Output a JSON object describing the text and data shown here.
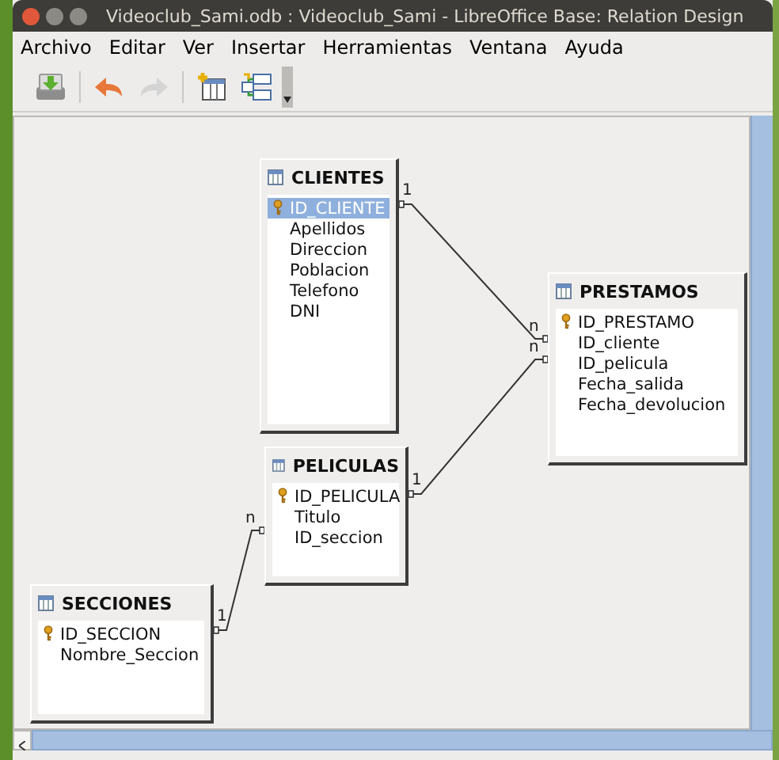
{
  "window": {
    "title": "Videoclub_Sami.odb : Videoclub_Sami - LibreOffice Base: Relation Design"
  },
  "menu": [
    "Archivo",
    "Editar",
    "Ver",
    "Insertar",
    "Herramientas",
    "Ventana",
    "Ayuda"
  ],
  "toolbar": [
    {
      "kind": "save",
      "disabled": false
    },
    {
      "kind": "undo",
      "disabled": false
    },
    {
      "kind": "redo",
      "disabled": true
    },
    {
      "kind": "add-table",
      "disabled": false
    },
    {
      "kind": "new-relation",
      "disabled": false
    }
  ],
  "tables": [
    {
      "name": "CLIENTES",
      "fields": [
        {
          "name": "ID_CLIENTE",
          "primary_key": true,
          "selected": true
        },
        {
          "name": "Apellidos",
          "primary_key": false,
          "selected": false
        },
        {
          "name": "Direccion",
          "primary_key": false,
          "selected": false
        },
        {
          "name": "Poblacion",
          "primary_key": false,
          "selected": false
        },
        {
          "name": "Telefono",
          "primary_key": false,
          "selected": false
        },
        {
          "name": "DNI",
          "primary_key": false,
          "selected": false
        }
      ]
    },
    {
      "name": "PRESTAMOS",
      "fields": [
        {
          "name": "ID_PRESTAMO",
          "primary_key": true,
          "selected": false
        },
        {
          "name": "ID_cliente",
          "primary_key": false,
          "selected": false
        },
        {
          "name": "ID_pelicula",
          "primary_key": false,
          "selected": false
        },
        {
          "name": "Fecha_salida",
          "primary_key": false,
          "selected": false
        },
        {
          "name": "Fecha_devolucion",
          "primary_key": false,
          "selected": false
        }
      ]
    },
    {
      "name": "PELICULAS",
      "fields": [
        {
          "name": "ID_PELICULA",
          "primary_key": true,
          "selected": false
        },
        {
          "name": "Titulo",
          "primary_key": false,
          "selected": false
        },
        {
          "name": "ID_seccion",
          "primary_key": false,
          "selected": false
        }
      ]
    },
    {
      "name": "SECCIONES",
      "fields": [
        {
          "name": "ID_SECCION",
          "primary_key": true,
          "selected": false
        },
        {
          "name": "Nombre_Seccion",
          "primary_key": false,
          "selected": false
        }
      ]
    }
  ],
  "relations": [
    {
      "from_label": "1",
      "to_label": "n"
    },
    {
      "from_label": "1",
      "to_label": "n"
    },
    {
      "from_label": "1",
      "to_label": "n"
    }
  ]
}
